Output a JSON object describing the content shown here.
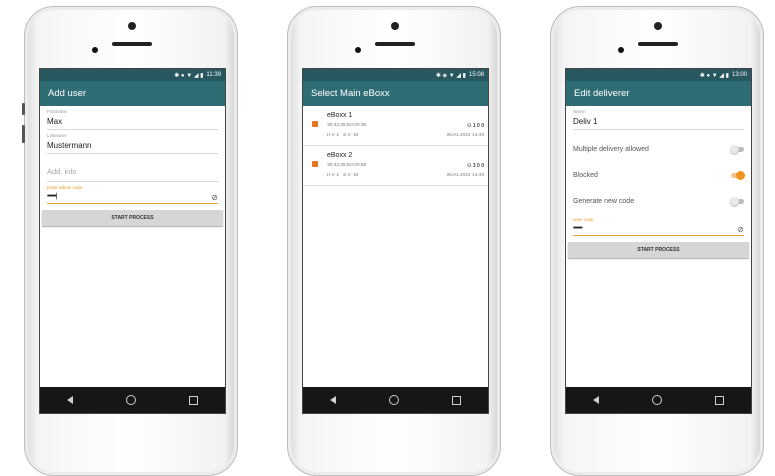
{
  "phones": [
    {
      "status_time": "11:39",
      "title": "Add user",
      "fields": [
        {
          "label": "Firstname",
          "value": "Max"
        },
        {
          "label": "Lastname",
          "value": "Mustermann"
        },
        {
          "placeholder": "Add. info"
        },
        {
          "label": "Enter admin code",
          "value": "••••••|"
        }
      ],
      "button": "START PROCESS"
    },
    {
      "status_time": "15:08",
      "title": "Select Main eBoxx",
      "items": [
        {
          "name": "eBoxx 1",
          "mac": "30:42:25:E0:00:36",
          "stats": "1 0 0",
          "hv": "H.V 1",
          "sv": "S.V. 10",
          "date": "06.01.2021 14:49"
        },
        {
          "name": "eBoxx 2",
          "mac": "30:42:25:E0:00:58",
          "stats": "3 0 0",
          "hv": "H.V 1",
          "sv": "S.V. 10",
          "date": "06.01.2021 14:49"
        }
      ]
    },
    {
      "status_time": "13:00",
      "title": "Edit deliverer",
      "name_label": "Name",
      "name_value": "Deliv 1",
      "toggles": [
        {
          "label": "Multiple delivery allowed",
          "on": false
        },
        {
          "label": "Blocked",
          "on": true
        },
        {
          "label": "Generate new code",
          "on": false
        }
      ],
      "code_label": "User code",
      "code_value": "••••••",
      "button": "START PROCESS"
    }
  ]
}
